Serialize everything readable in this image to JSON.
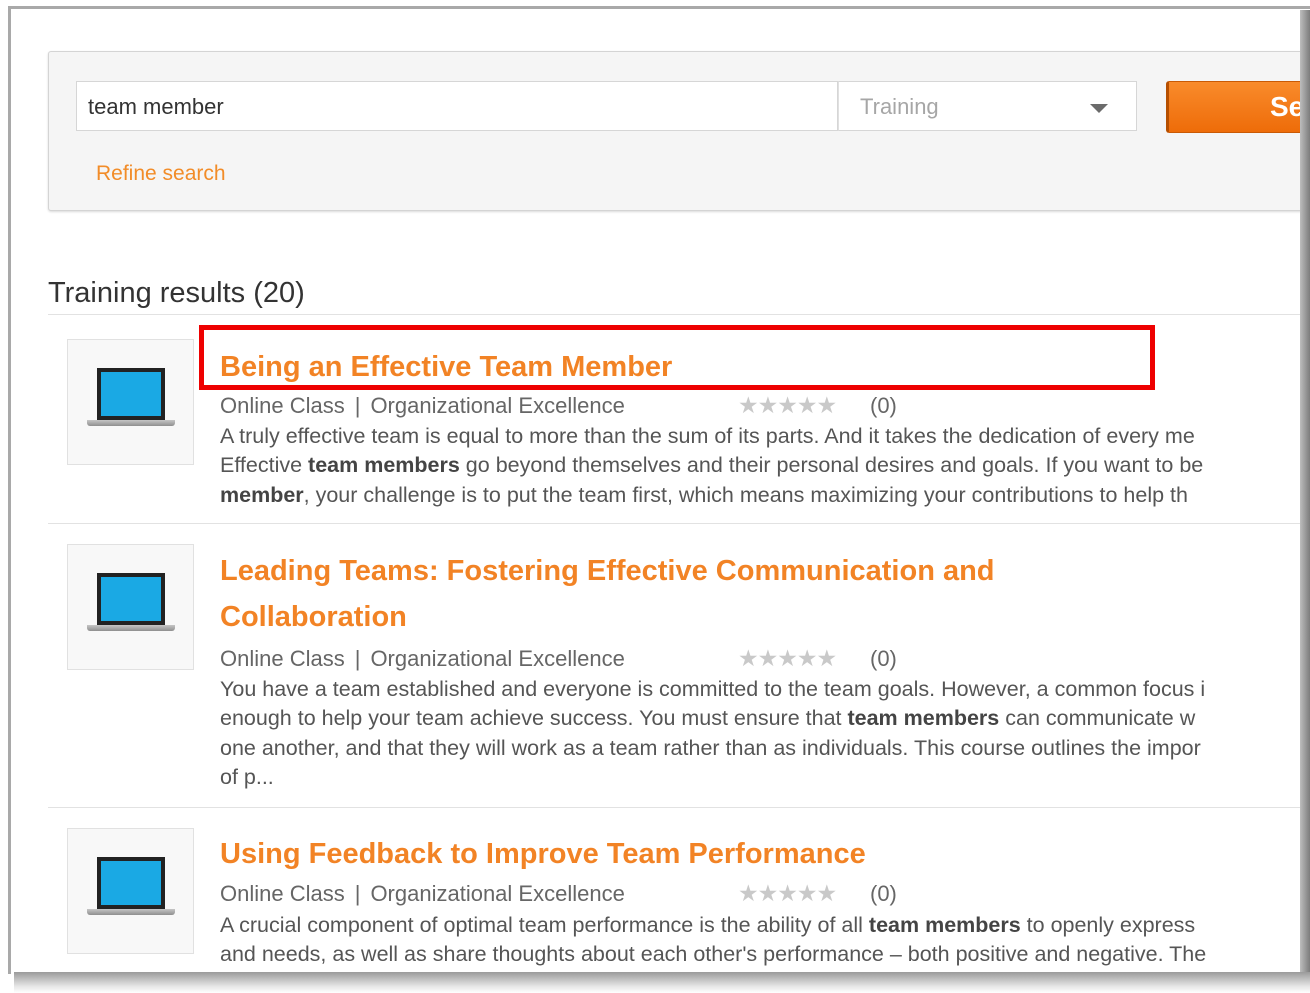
{
  "search": {
    "query": "team member",
    "type_selected": "Training",
    "button_label": "Se",
    "refine_label": "Refine search"
  },
  "results": {
    "heading": "Training results (20)",
    "items": [
      {
        "title": "Being an Effective Team Member",
        "format": "Online Class",
        "separator": "|",
        "category": "Organizational Excellence",
        "stars": "★★★★★",
        "rating_count": "(0)",
        "desc_lines": [
          {
            "pre": "A truly effective team is equal to more than the sum of its parts. And it takes the dedication of every me",
            "bold": "",
            "post": ""
          },
          {
            "pre": "Effective ",
            "bold": "team members",
            "post": " go beyond themselves and their personal desires and goals. If you want to be"
          },
          {
            "pre": "",
            "bold": "member",
            "post": ", your challenge is to put the team first, which means maximizing your contributions to help th"
          }
        ]
      },
      {
        "title": "Leading Teams: Fostering Effective Communication and Collaboration",
        "format": "Online Class",
        "separator": "|",
        "category": "Organizational Excellence",
        "stars": "★★★★★",
        "rating_count": "(0)",
        "desc_lines": [
          {
            "pre": "You have a team established and everyone is committed to the team goals. However, a common focus i",
            "bold": "",
            "post": ""
          },
          {
            "pre": "enough to help your team achieve success. You must ensure that ",
            "bold": "team members",
            "post": " can communicate w"
          },
          {
            "pre": "one another, and that they will work as a team rather than as individuals. This course outlines the impor",
            "bold": "",
            "post": ""
          },
          {
            "pre": "of p...",
            "bold": "",
            "post": ""
          }
        ]
      },
      {
        "title": "Using Feedback to Improve Team Performance",
        "format": "Online Class",
        "separator": "|",
        "category": "Organizational Excellence",
        "stars": "★★★★★",
        "rating_count": "(0)",
        "desc_lines": [
          {
            "pre": "A crucial component of optimal team performance is the ability of all ",
            "bold": "team members",
            "post": " to openly express"
          },
          {
            "pre": "and needs, as well as share thoughts about each other's performance – both positive and negative. The",
            "bold": "",
            "post": ""
          }
        ]
      }
    ]
  },
  "colors": {
    "accent_orange": "#f28325",
    "highlight_red": "#ee0000",
    "laptop_screen": "#1aa9e4"
  },
  "icons": {
    "thumbnail": "laptop-icon",
    "dropdown": "chevron-down-icon",
    "rating": "star-icon"
  }
}
